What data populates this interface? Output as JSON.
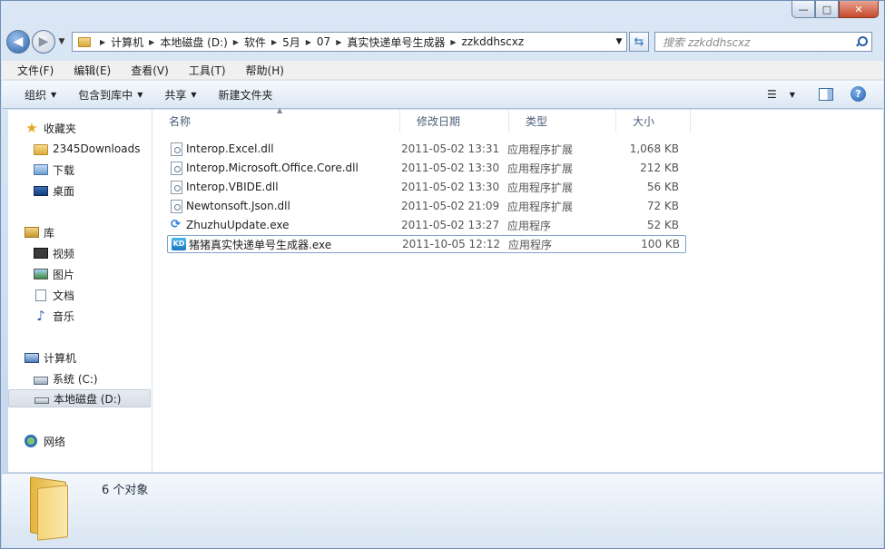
{
  "window": {
    "controls": [
      "—",
      "□",
      "✕"
    ]
  },
  "nav": {
    "breadcrumbs": [
      "计算机",
      "本地磁盘 (D:)",
      "软件",
      "5月",
      "07",
      "真实快递单号生成器",
      "zzkddhscxz"
    ],
    "search_placeholder": "搜索 zzkddhscxz"
  },
  "menu": [
    "文件(F)",
    "编辑(E)",
    "查看(V)",
    "工具(T)",
    "帮助(H)"
  ],
  "commands": [
    {
      "label": "组织",
      "has_dropdown": true
    },
    {
      "label": "包含到库中",
      "has_dropdown": true
    },
    {
      "label": "共享",
      "has_dropdown": true
    },
    {
      "label": "新建文件夹",
      "has_dropdown": false
    }
  ],
  "help_label": "?",
  "sidebar": {
    "favorites": {
      "label": "收藏夹",
      "items": [
        "2345Downloads",
        "下载",
        "桌面"
      ]
    },
    "libraries": {
      "label": "库",
      "items": [
        "视频",
        "图片",
        "文档",
        "音乐"
      ]
    },
    "computer": {
      "label": "计算机",
      "items": [
        "系统 (C:)",
        "本地磁盘 (D:)"
      ],
      "selected": "本地磁盘 (D:)"
    },
    "network": {
      "label": "网络"
    }
  },
  "columns": [
    "名称",
    "修改日期",
    "类型",
    "大小"
  ],
  "files": [
    {
      "name": "Interop.Excel.dll",
      "date": "2011-05-02 13:31",
      "type": "应用程序扩展",
      "size": "1,068 KB",
      "icon": "dll-icon"
    },
    {
      "name": "Interop.Microsoft.Office.Core.dll",
      "date": "2011-05-02 13:30",
      "type": "应用程序扩展",
      "size": "212 KB",
      "icon": "dll-icon"
    },
    {
      "name": "Interop.VBIDE.dll",
      "date": "2011-05-02 13:30",
      "type": "应用程序扩展",
      "size": "56 KB",
      "icon": "dll-icon"
    },
    {
      "name": "Newtonsoft.Json.dll",
      "date": "2011-05-02 21:09",
      "type": "应用程序扩展",
      "size": "72 KB",
      "icon": "dll-icon"
    },
    {
      "name": "ZhuzhuUpdate.exe",
      "date": "2011-05-02 13:27",
      "type": "应用程序",
      "size": "52 KB",
      "icon": "update-icon"
    },
    {
      "name": "猪猪真实快递单号生成器.exe",
      "date": "2011-10-05 12:12",
      "type": "应用程序",
      "size": "100 KB",
      "icon": "kd-icon",
      "icon_text": "KD",
      "selected": true
    }
  ],
  "status": {
    "count_text": "6 个对象"
  }
}
